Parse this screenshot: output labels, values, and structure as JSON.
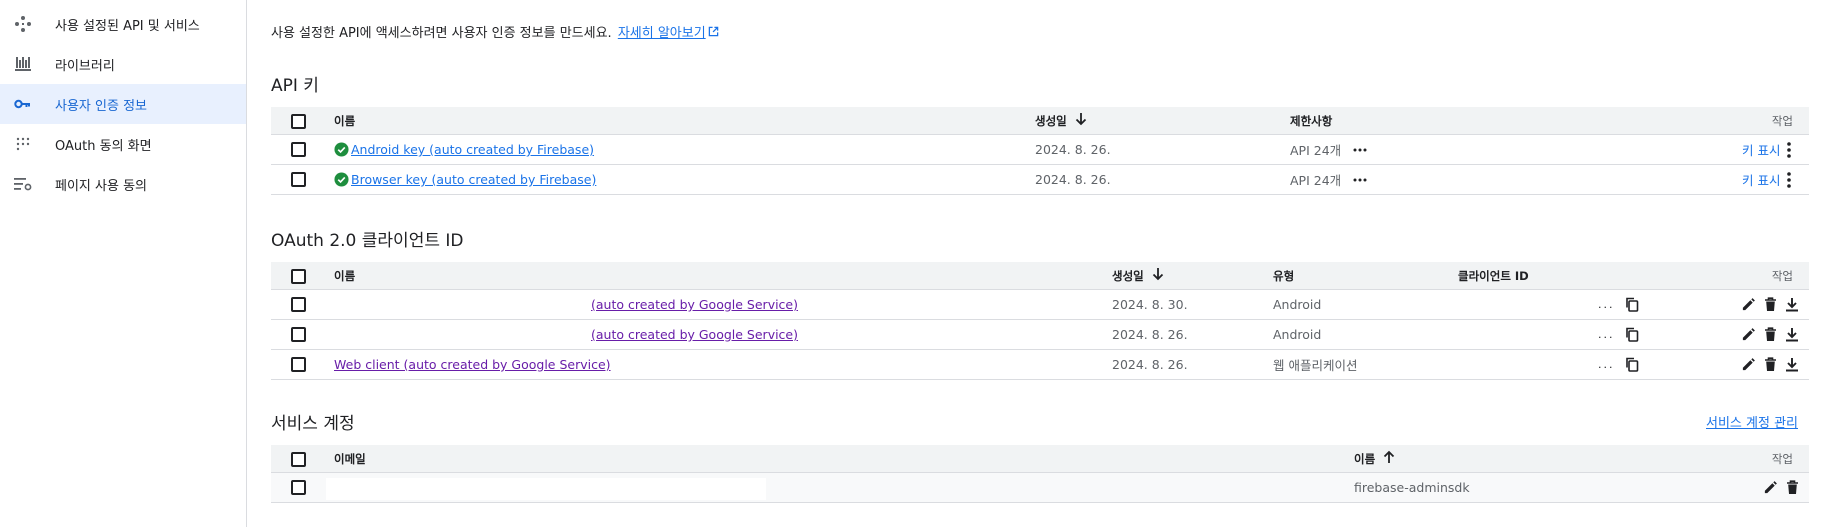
{
  "sidebar": {
    "items": [
      {
        "label": "사용 설정된 API 및 서비스",
        "icon": "api-diamond-icon",
        "active": false
      },
      {
        "label": "라이브러리",
        "icon": "library-icon",
        "active": false
      },
      {
        "label": "사용자 인증 정보",
        "icon": "key-icon",
        "active": true
      },
      {
        "label": "OAuth 동의 화면",
        "icon": "oauth-dots-icon",
        "active": false
      },
      {
        "label": "페이지 사용 동의",
        "icon": "page-settings-icon",
        "active": false
      }
    ]
  },
  "intro": {
    "text": "사용 설정한 API에 액세스하려면 사용자 인증 정보를 만드세요.",
    "link": "자세히 알아보기"
  },
  "api_keys": {
    "title": "API 키",
    "headers": {
      "name": "이름",
      "created": "생성일",
      "restrictions": "제한사항",
      "actions": "작업"
    },
    "rows": [
      {
        "name": "Android key (auto created by Firebase)",
        "created": "2024. 8. 26.",
        "restrictions": "API 24개",
        "show_key": "키 표시"
      },
      {
        "name": "Browser key (auto created by Firebase)",
        "created": "2024. 8. 26.",
        "restrictions": "API 24개",
        "show_key": "키 표시"
      }
    ]
  },
  "oauth": {
    "title": "OAuth 2.0 클라이언트 ID",
    "headers": {
      "name": "이름",
      "created": "생성일",
      "type": "유형",
      "client_id": "클라이언트 ID",
      "actions": "작업"
    },
    "rows": [
      {
        "name": "(auto created by Google Service)",
        "created": "2024. 8. 30.",
        "type": "Android",
        "client_id": "..."
      },
      {
        "name": "(auto created by Google Service)",
        "created": "2024. 8. 26.",
        "type": "Android",
        "client_id": "..."
      },
      {
        "name": "Web client (auto created by Google Service)",
        "created": "2024. 8. 26.",
        "type": "웹 애플리케이션",
        "client_id": "..."
      }
    ]
  },
  "service_accounts": {
    "title": "서비스 계정",
    "manage_link": "서비스 계정 관리",
    "headers": {
      "email": "이메일",
      "name": "이름",
      "actions": "작업"
    },
    "rows": [
      {
        "email": "",
        "name": "firebase-adminsdk"
      }
    ]
  },
  "colors": {
    "accent": "#1a73e8",
    "active_bg": "#e8f0fe",
    "visited_link": "#681da8",
    "success": "#1e8e3e",
    "header_bg": "#f1f3f4"
  }
}
